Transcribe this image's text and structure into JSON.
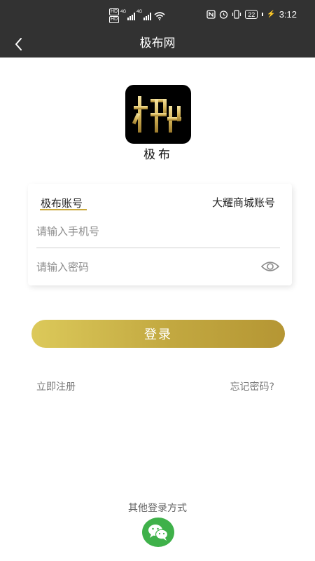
{
  "status_bar": {
    "hd_badges": [
      "HD",
      "HD"
    ],
    "network_gen": [
      "4G",
      "4G"
    ],
    "battery": "22",
    "time": "3:12"
  },
  "nav": {
    "title": "极布网",
    "back_icon": "chevron-left-icon"
  },
  "logo": {
    "text": "极布"
  },
  "login_form": {
    "tabs": [
      {
        "label": "极布账号",
        "active": true
      },
      {
        "label": "大耀商城账号",
        "active": false
      }
    ],
    "phone_placeholder": "请输入手机号",
    "phone_value": "",
    "password_placeholder": "请输入密码",
    "password_value": "",
    "toggle_icon": "eye-icon"
  },
  "actions": {
    "login_label": "登录",
    "register_label": "立即注册",
    "forgot_label": "忘记密码?"
  },
  "other_login": {
    "label": "其他登录方式",
    "wechat_icon": "wechat-icon"
  },
  "colors": {
    "header_bg": "#323232",
    "accent_gold": "#c9a83c",
    "wechat_green": "#3fb14a"
  }
}
